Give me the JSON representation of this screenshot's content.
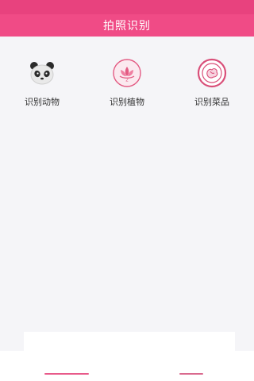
{
  "header": {
    "title": "拍照识别"
  },
  "features": [
    {
      "label": "识别动物",
      "icon": "panda-icon"
    },
    {
      "label": "识别植物",
      "icon": "lotus-icon"
    },
    {
      "label": "识别菜品",
      "icon": "dish-icon"
    }
  ],
  "colors": {
    "status_bar": "#e8427e",
    "header_bg": "#f04b86",
    "content_bg": "#f5f5f8",
    "accent": "#e35b83",
    "nav_active": "#e85a8a",
    "nav_inactive": "#d96a8e"
  },
  "bottom_nav": [
    {
      "icon": "nav-tab-indicator-icon"
    },
    {
      "icon": "nav-tab-indicator-icon"
    }
  ]
}
